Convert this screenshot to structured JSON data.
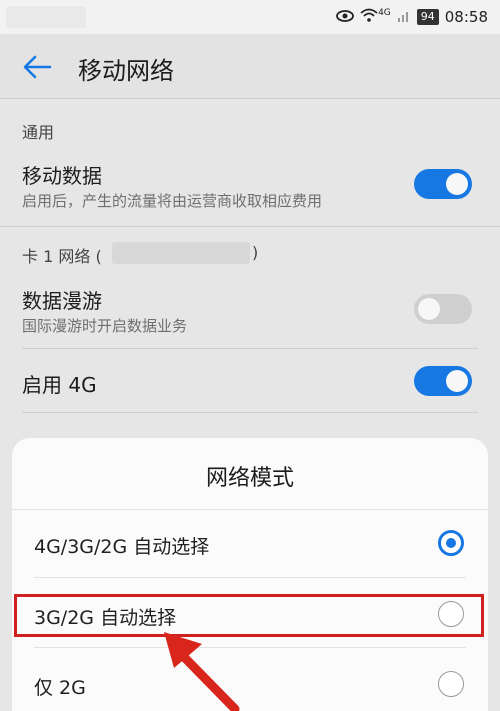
{
  "statusbar": {
    "network_label": "4G",
    "battery": "94",
    "time": "08:58"
  },
  "appbar": {
    "title": "移动网络"
  },
  "sections": {
    "general": "通用",
    "card1": "卡 1 网络 (",
    "card1_close": ")"
  },
  "items": {
    "mobile_data": {
      "title": "移动数据",
      "subtitle": "启用后，产生的流量将由运营商收取相应费用",
      "state": "on"
    },
    "roaming": {
      "title": "数据漫游",
      "subtitle": "国际漫游时开启数据业务",
      "state": "off"
    },
    "enable_4g": {
      "title": "启用 4G",
      "state": "on"
    }
  },
  "dialog": {
    "title": "网络模式",
    "options": [
      {
        "label": "4G/3G/2G 自动选择",
        "selected": true
      },
      {
        "label": "3G/2G 自动选择",
        "selected": false
      },
      {
        "label": "仅 2G",
        "selected": false
      }
    ]
  },
  "colors": {
    "accent": "#1878e3",
    "highlight": "#d02020"
  }
}
